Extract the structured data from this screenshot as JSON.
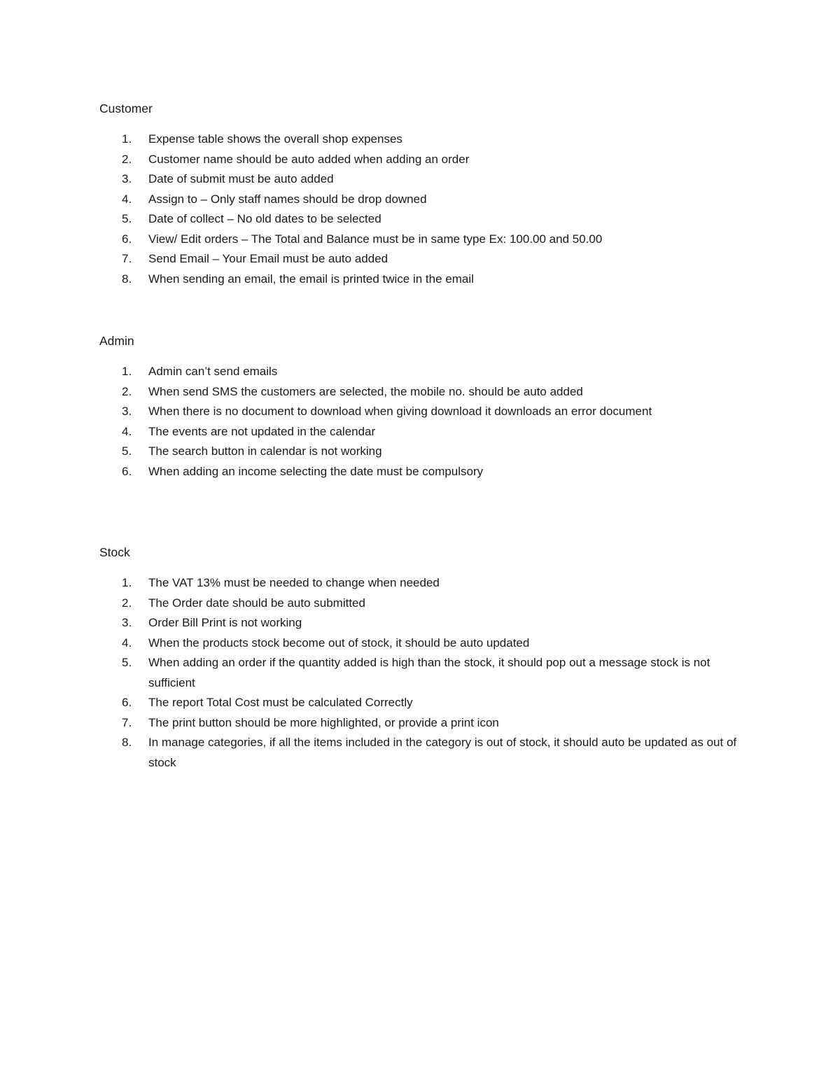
{
  "sections": [
    {
      "heading": "Customer",
      "items": [
        "Expense table shows the overall shop expenses",
        "Customer name should be auto added when adding an order",
        "Date of submit must be auto added",
        "Assign to – Only staff names should be drop downed",
        "Date of collect – No old dates to be selected",
        "View/ Edit orders – The Total and Balance must be in same type Ex: 100.00 and 50.00",
        "Send Email – Your Email must be auto added",
        "When sending an email, the email is printed twice in the email"
      ]
    },
    {
      "heading": "Admin",
      "items": [
        "Admin can’t send emails",
        "When send SMS the customers are selected, the mobile no. should be auto added",
        "When there is no document to download when giving download it downloads an error document",
        "The events are not updated in the calendar",
        "The search button in calendar is not working",
        "When adding an income selecting the date must be compulsory"
      ]
    },
    {
      "heading": "Stock",
      "items": [
        "The VAT 13% must be needed to change when needed",
        "The Order date should be auto submitted",
        "Order Bill Print is not working",
        "When the products stock become out of stock, it should be auto updated",
        "When adding an order if the quantity added is high than the stock, it should pop out a message stock is not sufficient",
        "The report Total Cost must be calculated Correctly",
        "The print button should be more highlighted, or provide a print icon",
        "In manage categories, if all the items included in the category is out of stock, it should auto be updated as out of stock"
      ]
    }
  ]
}
